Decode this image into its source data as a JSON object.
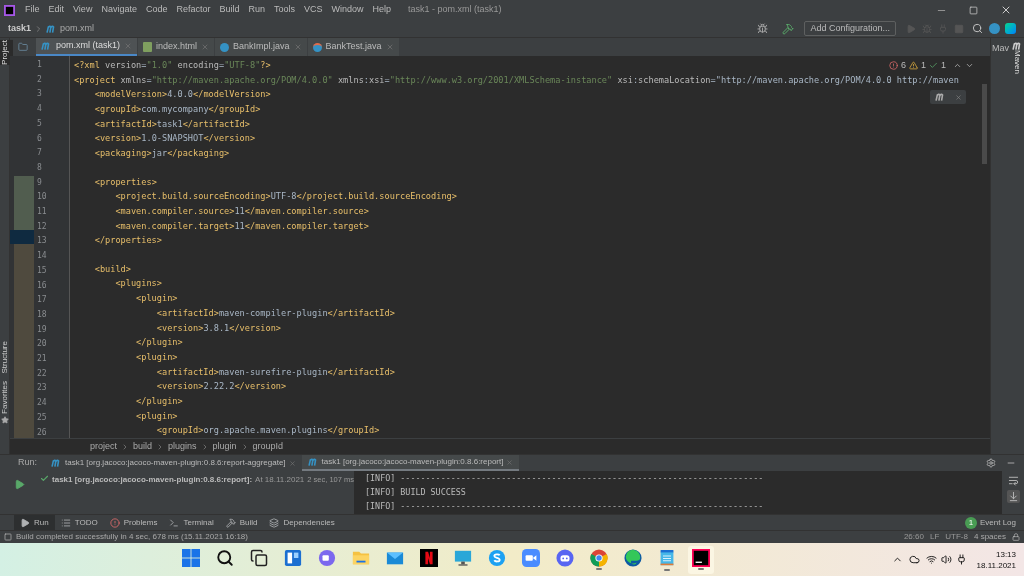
{
  "menu_bar": {
    "items": [
      "File",
      "Edit",
      "View",
      "Navigate",
      "Code",
      "Refactor",
      "Build",
      "Run",
      "Tools",
      "VCS",
      "Window",
      "Help"
    ],
    "window_title": "task1 - pom.xml (task1)"
  },
  "nav_bar": {
    "breadcrumb": [
      "task1",
      "pom.xml"
    ],
    "add_configuration": "Add Configuration..."
  },
  "editor_tabs": [
    {
      "label": "pom.xml (task1)",
      "kind": "maven",
      "selected": true
    },
    {
      "label": "index.html",
      "kind": "html",
      "selected": false
    },
    {
      "label": "BankImpl.java",
      "kind": "class",
      "selected": false
    },
    {
      "label": "BankTest.java",
      "kind": "test",
      "selected": false
    }
  ],
  "side_tools": {
    "left_top": "Project",
    "left_middle": "Structure",
    "left_bottom": "Favorites",
    "right": "Maven",
    "right_header": "Mav"
  },
  "inspections": {
    "errors": "6",
    "warnings": "1",
    "weak_warnings": "1"
  },
  "editor": {
    "lines": [
      {
        "number": "1",
        "text": "<?xml version=\"1.0\" encoding=\"UTF-8\"?>"
      },
      {
        "number": "2",
        "text": "<project xmlns=\"http://maven.apache.org/POM/4.0.0\" xmlns:xsi=\"http://www.w3.org/2001/XMLSchema-instance\" xsi:schemaLocation=\"http://maven.apache.org/POM/4.0.0 http://maven"
      },
      {
        "number": "3",
        "text": "    <modelVersion>4.0.0</modelVersion>"
      },
      {
        "number": "4",
        "text": "    <groupId>com.mycompany</groupId>"
      },
      {
        "number": "5",
        "text": "    <artifactId>task1</artifactId>"
      },
      {
        "number": "6",
        "text": "    <version>1.0-SNAPSHOT</version>"
      },
      {
        "number": "7",
        "text": "    <packaging>jar</packaging>"
      },
      {
        "number": "8"
      },
      {
        "number": "9",
        "text": "    <properties>"
      },
      {
        "number": "10",
        "text": "        <project.build.sourceEncoding>UTF-8</project.build.sourceEncoding>"
      },
      {
        "number": "11",
        "text": "        <maven.compiler.source>11</maven.compiler.source>"
      },
      {
        "number": "12",
        "text": "        <maven.compiler.target>11</maven.compiler.target>"
      },
      {
        "number": "13",
        "text": "    </properties>"
      },
      {
        "number": "14"
      },
      {
        "number": "15",
        "text": "    <build>"
      },
      {
        "number": "16",
        "text": "        <plugins>"
      },
      {
        "number": "17",
        "text": "            <plugin>"
      },
      {
        "number": "18",
        "text": "                <artifactId>maven-compiler-plugin</artifactId>"
      },
      {
        "number": "19",
        "text": "                <version>3.8.1</version>"
      },
      {
        "number": "20",
        "text": "            </plugin>"
      },
      {
        "number": "21",
        "text": "            <plugin>"
      },
      {
        "number": "22",
        "text": "                <artifactId>maven-surefire-plugin</artifactId>"
      },
      {
        "number": "23",
        "text": "                <version>2.22.2</version>"
      },
      {
        "number": "24",
        "text": "            </plugin>"
      },
      {
        "number": "25",
        "text": "            <plugin>"
      },
      {
        "number": "26",
        "text": "                <groupId>org.apache.maven.plugins</groupId>"
      }
    ]
  },
  "breadcrumb": [
    "project",
    "build",
    "plugins",
    "plugin",
    "groupId"
  ],
  "run_panel": {
    "label": "Run:",
    "tabs": [
      {
        "label": "task1 [org.jacoco:jacoco-maven-plugin:0.8.6:report-aggregate]",
        "selected": false
      },
      {
        "label": "task1 [org.jacoco:jacoco-maven-plugin:0.8.6:report]",
        "selected": true
      }
    ],
    "tree_item": {
      "label": "task1 [org.jacoco:jacoco-maven-plugin:0.8.6:report]:",
      "time": "At 18.11.2021",
      "duration": "2 sec, 107 ms"
    },
    "console": [
      "[INFO] ------------------------------------------------------------------------",
      "[INFO] BUILD SUCCESS",
      "[INFO] ------------------------------------------------------------------------"
    ]
  },
  "tool_windows": [
    {
      "label": "Run",
      "kind": "run",
      "selected": true
    },
    {
      "label": "TODO",
      "kind": "todo",
      "selected": false
    },
    {
      "label": "Problems",
      "kind": "problems",
      "selected": false
    },
    {
      "label": "Terminal",
      "kind": "terminal",
      "selected": false
    },
    {
      "label": "Build",
      "kind": "build",
      "selected": false
    },
    {
      "label": "Dependencies",
      "kind": "dependencies",
      "selected": false
    }
  ],
  "event_log": {
    "count": "1",
    "label": "Event Log"
  },
  "status_bar": {
    "message": "Build completed successfully in 4 sec, 678 ms (15.11.2021 16:18)",
    "position": "26:60",
    "line_separator": "LF",
    "encoding": "UTF-8",
    "indent": "4 spaces"
  },
  "taskbar": {
    "apps": [
      {
        "kind": "start",
        "active": false
      },
      {
        "kind": "search",
        "active": false
      },
      {
        "kind": "taskview",
        "active": false
      },
      {
        "kind": "widgets",
        "active": false
      },
      {
        "kind": "chat",
        "active": false
      },
      {
        "kind": "explorer",
        "active": false
      },
      {
        "kind": "mail",
        "active": false
      },
      {
        "kind": "netflix",
        "active": false
      },
      {
        "kind": "monitor",
        "active": false
      },
      {
        "kind": "skype",
        "active": false
      },
      {
        "kind": "zoom",
        "active": false
      },
      {
        "kind": "discord",
        "active": false
      },
      {
        "kind": "chrome",
        "active": true
      },
      {
        "kind": "edge",
        "active": false
      },
      {
        "kind": "notepad",
        "active": true
      },
      {
        "kind": "intellij",
        "active": true
      }
    ],
    "time": "13:13",
    "date": "18.11.2021"
  }
}
